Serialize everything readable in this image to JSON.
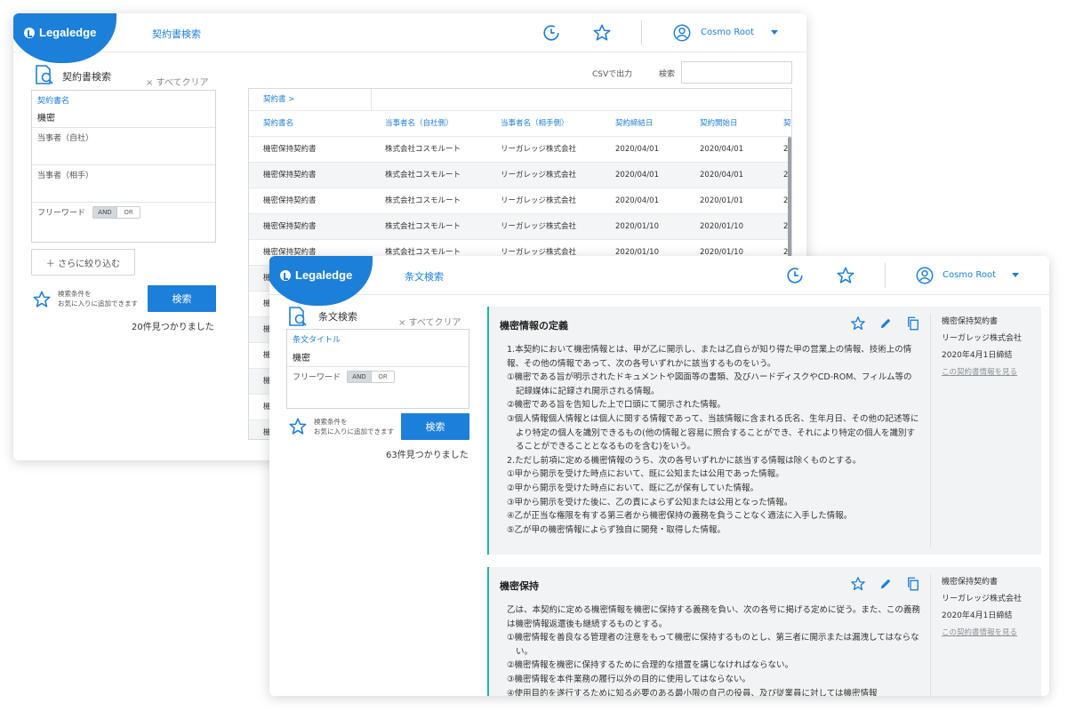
{
  "brand": "Legaledge",
  "user": "Cosmo Root",
  "contract_window": {
    "header_title": "契約書検索",
    "panel_title": "契約書検索",
    "clear_all": "× すべてクリア",
    "fields": [
      {
        "label": "契約書名",
        "value": "機密"
      },
      {
        "label": "当事者（自社）",
        "value": ""
      },
      {
        "label": "当事者（相手）",
        "value": ""
      }
    ],
    "freeword_label": "フリーワード",
    "toggle_and": "AND",
    "toggle_or": "OR",
    "narrow_button": "＋ さらに絞り込む",
    "fav_text_line1": "検索条件を",
    "fav_text_line2": "お気に入りに追加できます",
    "search_button": "検索",
    "result_count": "20件見つかりました",
    "csv_label": "CSVで出力",
    "search_label": "検索",
    "breadcrumb": "契約書 >",
    "columns": [
      "契約書名",
      "当事者名（自社側）",
      "当事者名（相手側）",
      "契約締結日",
      "契約開始日",
      "契"
    ],
    "rows": [
      [
        "機密保持契約書",
        "株式会社コスモルート",
        "リーガレッジ株式会社",
        "2020/04/01",
        "2020/04/01",
        "2"
      ],
      [
        "機密保持契約書",
        "株式会社コスモルート",
        "リーガレッジ株式会社",
        "2020/04/01",
        "2020/04/01",
        "2"
      ],
      [
        "機密保持契約書",
        "株式会社コスモルート",
        "リーガレッジ株式会社",
        "2020/04/01",
        "2020/01/01",
        "2"
      ],
      [
        "機密保持契約書",
        "株式会社コスモルート",
        "リーガレッジ株式会社",
        "2020/01/10",
        "2020/01/10",
        "2"
      ],
      [
        "機密保持契約書",
        "株式会社コスモルート",
        "リーガレッジ株式会社",
        "2020/01/10",
        "2020/01/10",
        "2"
      ],
      [
        "機",
        "",
        "",
        "",
        "",
        ""
      ],
      [
        "機",
        "",
        "",
        "",
        "",
        ""
      ],
      [
        "機",
        "",
        "",
        "",
        "",
        ""
      ],
      [
        "機",
        "",
        "",
        "",
        "",
        ""
      ],
      [
        "機",
        "",
        "",
        "",
        "",
        ""
      ],
      [
        "機",
        "",
        "",
        "",
        "",
        ""
      ],
      [
        "機",
        "",
        "",
        "",
        "",
        ""
      ]
    ]
  },
  "clause_window": {
    "header_title": "条文検索",
    "panel_title": "条文検索",
    "clear_all": "× すべてクリア",
    "title_field_label": "条文タイトル",
    "title_field_value": "機密",
    "freeword_label": "フリーワード",
    "toggle_and": "AND",
    "toggle_or": "OR",
    "fav_text_line1": "検索条件を",
    "fav_text_line2": "お気に入りに追加できます",
    "search_button": "検索",
    "result_count": "63件見つかりました",
    "cards": [
      {
        "title": "機密情報の定義",
        "lines": [
          "1.本契約において機密情報とは、甲が乙に開示し、または乙自らが知り得た甲の営業上の情報、技術上の情報、その他の情報であって、次の各号いずれかに該当するものをいう。",
          "①機密である旨が明示されたドキュメントや図面等の書類、及びハードディスクやCD-ROM、フィルム等の記録媒体に記録され開示される情報。",
          "②機密である旨を告知した上で口頭にて開示された情報。",
          "③個人情報個人情報とは個人に関する情報であって、当該情報に含まれる氏名、生年月日、その他の記述等により特定の個人を識別できるもの(他の情報と容易に照合することができ、それにより特定の個人を識別することができることとなるものを含む)をいう。",
          "2.ただし前項に定める機密情報のうち、次の各号いずれかに該当する情報は除くものとする。",
          "①甲から開示を受けた時点において、既に公知または公用であった情報。",
          "②甲から開示を受けた時点において、既に乙が保有していた情報。",
          "③甲から開示を受けた後に、乙の責によらず公知または公用となった情報。",
          "④乙が正当な権限を有する第三者から機密保持の義務を負うことなく適法に入手した情報。",
          "⑤乙が甲の機密情報によらず独自に開発・取得した情報。"
        ],
        "contract_name": "機密保持契約書",
        "counterparty": "リーガレッジ株式会社",
        "signed_date": "2020年4月1日締結",
        "link": "この契約書情報を見る"
      },
      {
        "title": "機密保持",
        "lines": [
          "乙は、本契約に定める機密情報を機密に保持する義務を負い、次の各号に掲げる定めに従う。また、この義務は機密情報返還後も継続するものとする。",
          "①機密情報を善良なる管理者の注意をもって機密に保持するものとし、第三者に開示または漏洩してはならない。",
          "②機密情報を機密に保持するために合理的な措置を講じなければならない。",
          "③機密情報を本件業務の履行以外の目的に使用してはならない。",
          "④使用目的を遂行するために知る必要のある最小限の自己の役員、及び従業員に対しては機密情報"
        ],
        "contract_name": "機密保持契約書",
        "counterparty": "リーガレッジ株式会社",
        "signed_date": "2020年4月1日締結",
        "link": "この契約書情報を見る"
      }
    ]
  }
}
